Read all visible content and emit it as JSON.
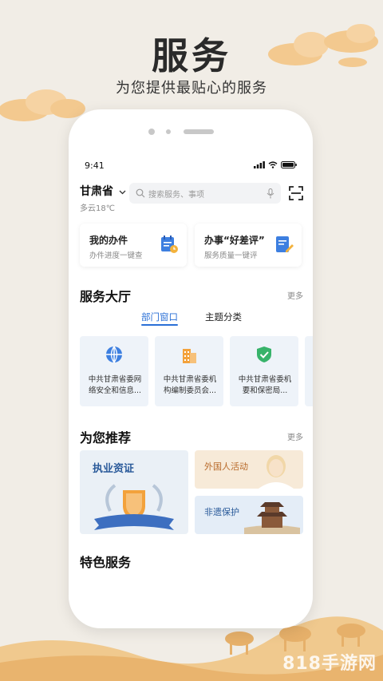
{
  "promo": {
    "title": "服务",
    "subtitle": "为您提供最贴心的服务"
  },
  "status_bar": {
    "time": "9:41"
  },
  "header": {
    "province": "甘肃省",
    "weather": "多云18℃",
    "search_placeholder": "搜索服务、事项"
  },
  "quick_cards": [
    {
      "title": "我的办件",
      "subtitle": "办件进度一键查",
      "icon": "clipboard-clock-icon"
    },
    {
      "title": "办事“好差评”",
      "subtitle": "服务质量一键评",
      "icon": "document-edit-icon"
    }
  ],
  "service_hall": {
    "title": "服务大厅",
    "more": "更多",
    "tabs": [
      "部门窗口",
      "主题分类"
    ],
    "active_tab": 0,
    "departments": [
      {
        "name": "中共甘肃省委网络安全和信息...",
        "icon": "globe-icon"
      },
      {
        "name": "中共甘肃省委机构编制委员会...",
        "icon": "building-icon"
      },
      {
        "name": "中共甘肃省委机要和保密局...",
        "icon": "shield-check-icon"
      }
    ]
  },
  "recommend": {
    "title": "为您推荐",
    "more": "更多",
    "items": [
      {
        "title": "执业资证",
        "icon": "badge-icon"
      },
      {
        "title": "外国人活动",
        "icon": "person-photo"
      },
      {
        "title": "非遗保护",
        "icon": "tower-photo"
      }
    ]
  },
  "featured": {
    "title": "特色服务"
  },
  "watermark": "818手游网",
  "colors": {
    "accent": "#2a6fd6",
    "background": "#f1ede6",
    "cloud": "#f3c98f"
  }
}
